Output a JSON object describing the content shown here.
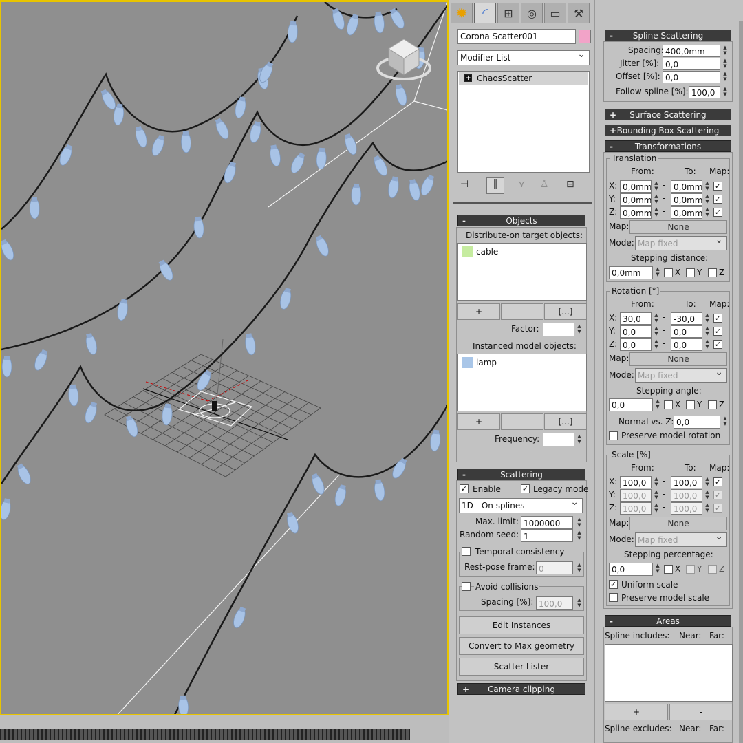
{
  "tabs": [
    {
      "name": "create-icon",
      "active": false
    },
    {
      "name": "modify-icon",
      "active": true
    },
    {
      "name": "hierarchy-icon",
      "active": false
    },
    {
      "name": "motion-icon",
      "active": false
    },
    {
      "name": "display-icon",
      "active": false
    },
    {
      "name": "utilities-icon",
      "active": false
    }
  ],
  "object": {
    "name": "Corona Scatter001",
    "color": "#f2a3c8"
  },
  "modifier_list": "Modifier List",
  "stack": {
    "expand": "+",
    "item": "ChaosScatter"
  },
  "objects_rollout": {
    "title": "Objects",
    "toggle": "-",
    "distribute_label": "Distribute-on target objects:",
    "distribute_items": [
      {
        "label": "cable",
        "color": "#c6eca0"
      }
    ],
    "add": "+",
    "remove": "-",
    "more": "[...]",
    "factor_label": "Factor:",
    "factor_value": "",
    "instanced_label": "Instanced model objects:",
    "instanced_items": [
      {
        "label": "lamp",
        "color": "#a9c6e8"
      }
    ],
    "frequency_label": "Frequency:",
    "frequency_value": ""
  },
  "scattering_rollout": {
    "title": "Scattering",
    "toggle": "-",
    "enable_label": "Enable",
    "enable": true,
    "legacy_label": "Legacy mode",
    "legacy": true,
    "mode": "1D - On splines",
    "max_limit_label": "Max. limit:",
    "max_limit": "1000000",
    "random_seed_label": "Random seed:",
    "random_seed": "1",
    "temporal_label": "Temporal consistency",
    "temporal": false,
    "rest_pose_label": "Rest-pose frame:",
    "rest_pose": "0",
    "avoid_label": "Avoid collisions",
    "avoid": false,
    "spacing_label": "Spacing [%]:",
    "spacing": "100,0",
    "edit_instances": "Edit Instances",
    "convert": "Convert to Max geometry",
    "lister": "Scatter Lister"
  },
  "camera_clipping": {
    "title": "Camera clipping",
    "toggle": "+"
  },
  "spline_scattering": {
    "title": "Spline Scattering",
    "toggle": "-",
    "spacing_label": "Spacing:",
    "spacing": "400,0mm",
    "jitter_label": "Jitter [%]:",
    "jitter": "0,0",
    "offset_label": "Offset [%]:",
    "offset": "0,0",
    "follow_label": "Follow spline [%]:",
    "follow": "100,0"
  },
  "surface_scattering": {
    "title": "Surface Scattering",
    "toggle": "+"
  },
  "bbox_scattering": {
    "title": "Bounding Box Scattering",
    "toggle": "+"
  },
  "transformations": {
    "title": "Transformations",
    "toggle": "-",
    "from_label": "From:",
    "to_label": "To:",
    "map_label": "Map:",
    "dash": "-",
    "translation": {
      "label": "Translation",
      "rows": [
        {
          "axis": "X:",
          "from": "0,0mm",
          "to": "0,0mm",
          "map": true
        },
        {
          "axis": "Y:",
          "from": "0,0mm",
          "to": "0,0mm",
          "map": true
        },
        {
          "axis": "Z:",
          "from": "0,0mm",
          "to": "0,0mm",
          "map": true
        }
      ],
      "map": "None",
      "mode_label": "Mode:",
      "mode": "Map fixed",
      "step_label": "Stepping distance:",
      "step": "0,0mm"
    },
    "rotation": {
      "label": "Rotation [°]",
      "rows": [
        {
          "axis": "X:",
          "from": "30,0",
          "to": "-30,0",
          "map": true
        },
        {
          "axis": "Y:",
          "from": "0,0",
          "to": "0,0",
          "map": true
        },
        {
          "axis": "Z:",
          "from": "0,0",
          "to": "0,0",
          "map": true
        }
      ],
      "map": "None",
      "mode_label": "Mode:",
      "mode": "Map fixed",
      "step_label": "Stepping angle:",
      "step": "0,0",
      "normal_label": "Normal vs. Z:",
      "normal": "0,0",
      "preserve_label": "Preserve model rotation"
    },
    "scale": {
      "label": "Scale [%]",
      "rows": [
        {
          "axis": "X:",
          "from": "100,0",
          "to": "100,0",
          "map": true
        },
        {
          "axis": "Y:",
          "from": "100,0",
          "to": "100,0",
          "map": true
        },
        {
          "axis": "Z:",
          "from": "100,0",
          "to": "100,0",
          "map": true
        }
      ],
      "map": "None",
      "mode_label": "Mode:",
      "mode": "Map fixed",
      "step_label": "Stepping percentage:",
      "step": "0,0",
      "uniform_label": "Uniform scale",
      "uniform": true,
      "preserve_label": "Preserve model scale"
    },
    "xyz": [
      "X",
      "Y",
      "Z"
    ]
  },
  "areas": {
    "title": "Areas",
    "toggle": "-",
    "includes_label": "Spline includes:",
    "near": "Near:",
    "far": "Far:",
    "add": "+",
    "remove": "-",
    "excludes_label": "Spline excludes:"
  },
  "colors": {
    "accent": "#e8c400",
    "viewport_bg": "#8f8f8f",
    "lamp": "#a8c3e6",
    "cable": "#1a1a1a"
  }
}
